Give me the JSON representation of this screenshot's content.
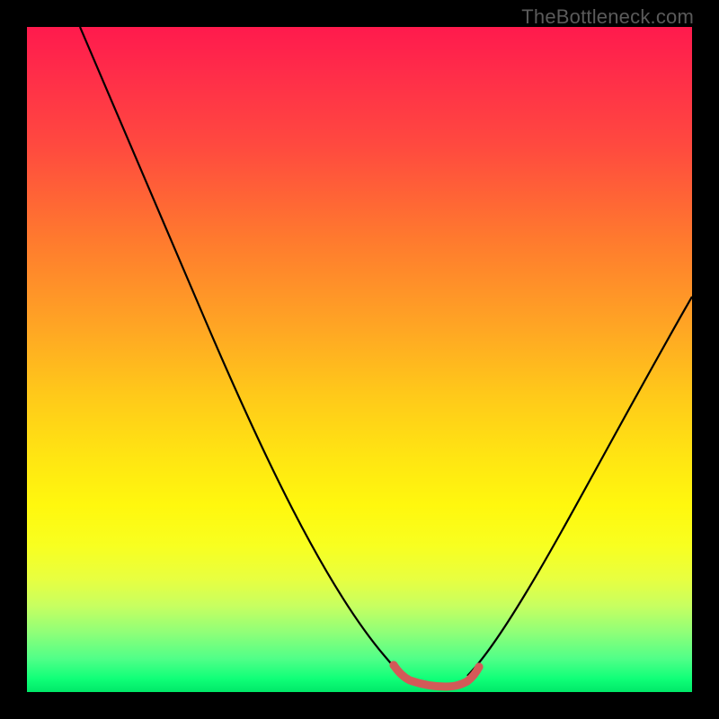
{
  "watermark": {
    "text": "TheBottleneck.com"
  },
  "colors": {
    "curve": "#000000",
    "marker": "#d35a58",
    "background_black": "#000000"
  },
  "chart_data": {
    "type": "line",
    "title": "",
    "xlabel": "",
    "ylabel": "",
    "xlim": [
      0,
      100
    ],
    "ylim": [
      0,
      100
    ],
    "grid": false,
    "legend": false,
    "series": [
      {
        "name": "left-curve",
        "x": [
          8,
          12,
          16,
          20,
          24,
          28,
          32,
          36,
          40,
          44,
          48,
          52,
          55,
          57
        ],
        "y": [
          100,
          92,
          84,
          76,
          68,
          60,
          52,
          44,
          36,
          28,
          20,
          12,
          6,
          2
        ]
      },
      {
        "name": "right-curve",
        "x": [
          66,
          68,
          72,
          76,
          80,
          84,
          88,
          92,
          96,
          100
        ],
        "y": [
          3,
          6,
          12,
          20,
          28,
          36,
          43,
          50,
          56,
          62
        ]
      },
      {
        "name": "minimum-band",
        "x": [
          55,
          57,
          59,
          61,
          63,
          65,
          67
        ],
        "y": [
          4,
          2.2,
          1.6,
          1.4,
          1.6,
          2.2,
          4
        ]
      }
    ],
    "annotations": []
  }
}
